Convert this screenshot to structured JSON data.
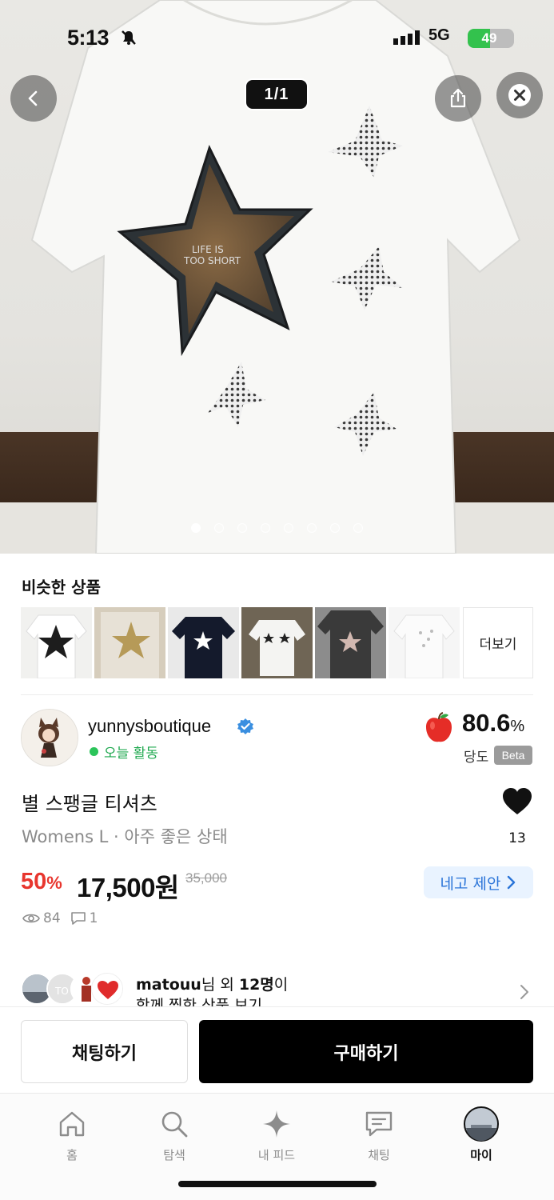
{
  "status_bar": {
    "time": "5:13",
    "network": "5G",
    "battery": "49",
    "battery_level": 0.49
  },
  "header": {
    "pager": "1/1"
  },
  "hero": {
    "slide_count": 8,
    "active_slide": 1,
    "shirt_text_line1": "LIFE IS",
    "shirt_text_line2": "TOO SHORT"
  },
  "similar": {
    "title": "비슷한 상품",
    "more_label": "더보기"
  },
  "seller": {
    "name": "yunnysboutique",
    "activity": "오늘 활동",
    "score": "80.6",
    "score_unit": "%",
    "score_label": "당도",
    "beta_label": "Beta"
  },
  "product": {
    "title": "별 스팽글 티셔츠",
    "meta": "Womens L · 아주 좋은 상태",
    "like_count": "13",
    "discount": "50",
    "discount_unit": "%",
    "price": "17,500원",
    "original_price": "35,000",
    "offer_label": "네고 제안",
    "views": "84",
    "chats": "1"
  },
  "likers": {
    "user": "matouu",
    "suffix_1": "님 외 ",
    "count": "12명",
    "suffix_2": "이",
    "line2": "함께 찜한 상품 보기"
  },
  "actions": {
    "chat_label": "채팅하기",
    "buy_label": "구매하기"
  },
  "tabbar": {
    "home": "홈",
    "explore": "탐색",
    "feed": "내 피드",
    "chat": "채팅",
    "my": "마이"
  },
  "colors": {
    "discount_red": "#e8362e",
    "offer_blue": "#2a74d8",
    "active_green": "#2bc45a",
    "buy_black": "#000000"
  }
}
